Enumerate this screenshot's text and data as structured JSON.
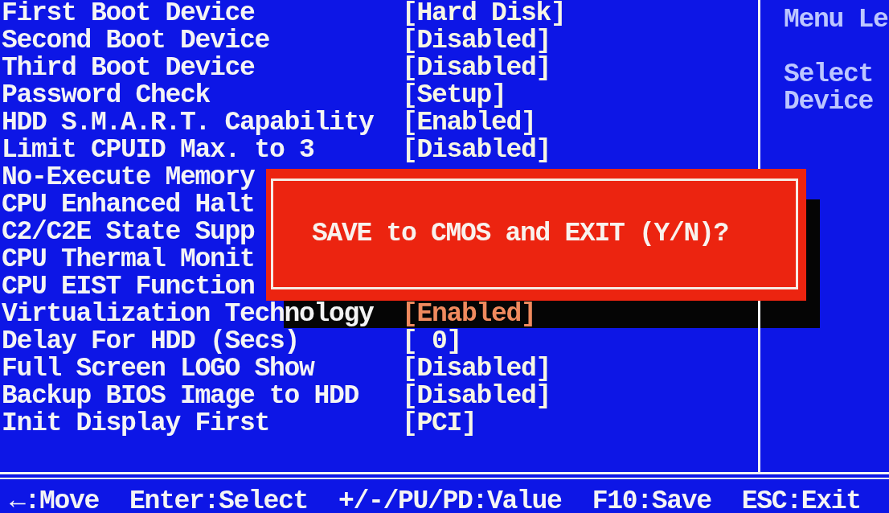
{
  "settings": [
    {
      "label": "First Boot Device",
      "value": "[Hard Disk]",
      "selected": false
    },
    {
      "label": "Second Boot Device",
      "value": "[Disabled]",
      "selected": false
    },
    {
      "label": "Third Boot Device",
      "value": "[Disabled]",
      "selected": false
    },
    {
      "label": "Password Check",
      "value": "[Setup]",
      "selected": false
    },
    {
      "label": "HDD S.M.A.R.T. Capability",
      "value": "[Enabled]",
      "selected": false
    },
    {
      "label": "Limit CPUID Max. to 3",
      "value": "[Disabled]",
      "selected": false
    },
    {
      "label": "No-Execute Memory",
      "selected": false
    },
    {
      "label": "CPU Enhanced Halt",
      "selected": false
    },
    {
      "label": "C2/C2E State Supp",
      "selected": false
    },
    {
      "label": "CPU Thermal Monit",
      "selected": false
    },
    {
      "label": "CPU EIST Function",
      "selected": false
    },
    {
      "label": "Virtualization Technology",
      "value": "[Enabled]",
      "selected": true
    },
    {
      "label": "Delay For HDD (Secs)",
      "value": "[ 0]",
      "selected": false
    },
    {
      "label": "Full Screen LOGO Show",
      "value": "[Disabled]",
      "selected": false
    },
    {
      "label": "Backup BIOS Image to HDD",
      "value": "[Disabled]",
      "selected": false
    },
    {
      "label": "Init Display First",
      "value": "[PCI]",
      "selected": false
    }
  ],
  "help_panel": {
    "title": "Menu Le",
    "lines": [
      "Select",
      "Device"
    ]
  },
  "dialog": {
    "message": "SAVE to CMOS and EXIT (Y/N)?"
  },
  "key_hints": [
    "←:Move",
    "Enter:Select",
    "+/-/PU/PD:Value",
    "F10:Save",
    "ESC:Exit"
  ]
}
